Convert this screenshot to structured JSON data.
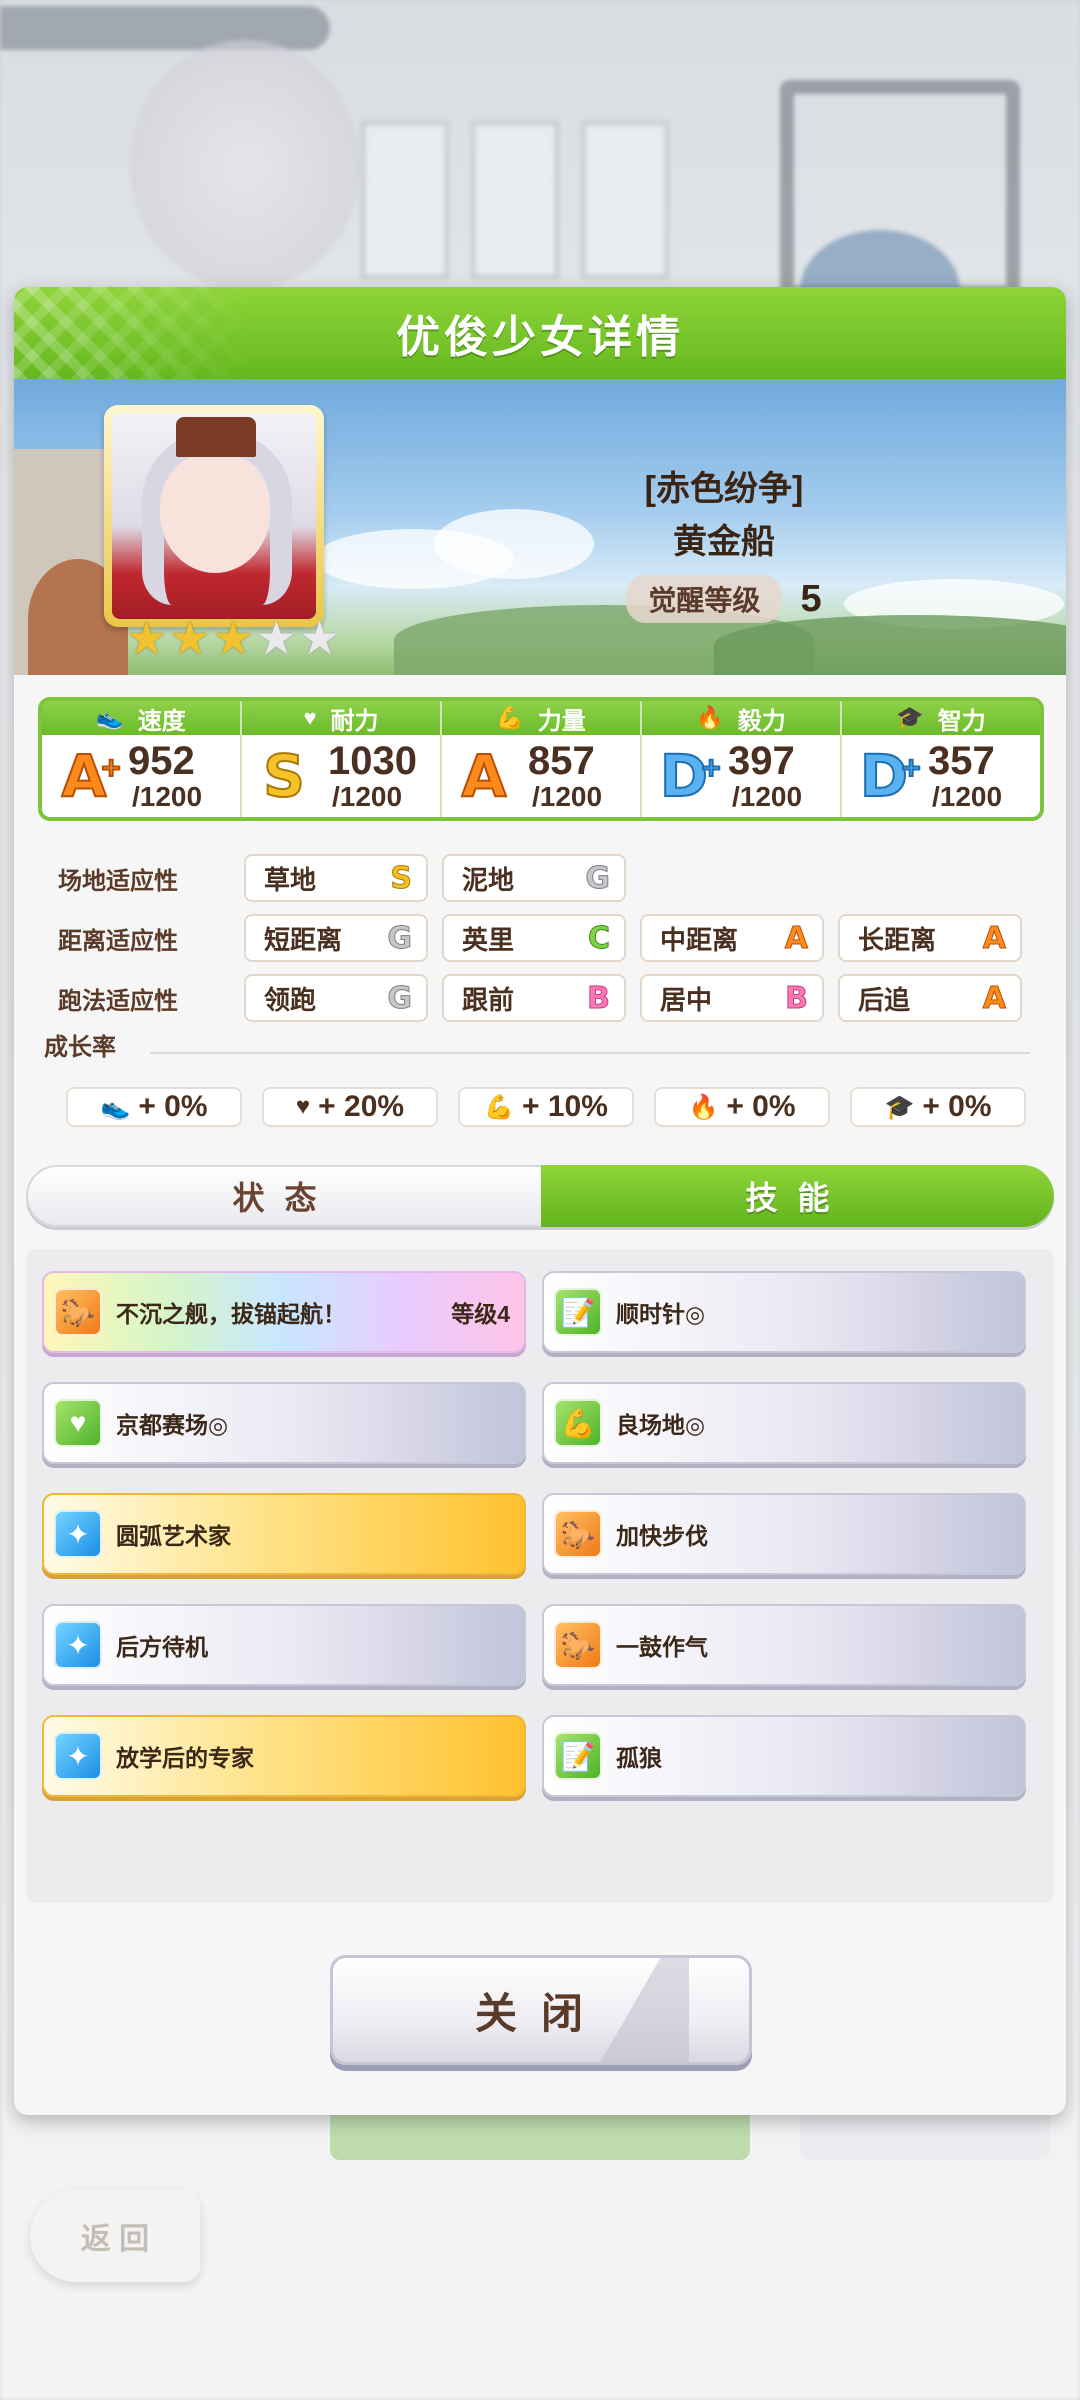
{
  "dialog": {
    "title": "优俊少女详情"
  },
  "background": {
    "back_label": "返 回"
  },
  "horse": {
    "epithet": "[赤色纷争]",
    "name": "黄金船",
    "awakening_label": "觉醒等级",
    "awakening_level": "5",
    "stars_filled": 3,
    "stars_total": 5
  },
  "stats": [
    {
      "label": "速度",
      "icon": "shoe-icon",
      "glyph": "👟",
      "grade": "A",
      "plus": "+",
      "grade_class": "g-A",
      "value": "952",
      "max": "/1200"
    },
    {
      "label": "耐力",
      "icon": "heart-icon",
      "glyph": "♥",
      "grade": "S",
      "plus": "",
      "grade_class": "g-S",
      "value": "1030",
      "max": "/1200"
    },
    {
      "label": "力量",
      "icon": "muscle-icon",
      "glyph": "💪",
      "grade": "A",
      "plus": "",
      "grade_class": "g-A",
      "value": "857",
      "max": "/1200"
    },
    {
      "label": "毅力",
      "icon": "flame-icon",
      "glyph": "🔥",
      "grade": "D",
      "plus": "+",
      "grade_class": "g-D",
      "value": "397",
      "max": "/1200"
    },
    {
      "label": "智力",
      "icon": "graduation-cap-icon",
      "glyph": "🎓",
      "grade": "D",
      "plus": "+",
      "grade_class": "g-D",
      "value": "357",
      "max": "/1200"
    }
  ],
  "aptitudes": {
    "track": {
      "label": "场地适应性",
      "items": [
        {
          "name": "草地",
          "grade": "S"
        },
        {
          "name": "泥地",
          "grade": "G"
        }
      ]
    },
    "distance": {
      "label": "距离适应性",
      "items": [
        {
          "name": "短距离",
          "grade": "G"
        },
        {
          "name": "英里",
          "grade": "C"
        },
        {
          "name": "中距离",
          "grade": "A"
        },
        {
          "name": "长距离",
          "grade": "A"
        }
      ]
    },
    "style": {
      "label": "跑法适应性",
      "items": [
        {
          "name": "领跑",
          "grade": "G"
        },
        {
          "name": "跟前",
          "grade": "B"
        },
        {
          "name": "居中",
          "grade": "B"
        },
        {
          "name": "后追",
          "grade": "A"
        }
      ]
    }
  },
  "growth": {
    "label": "成长率",
    "items": [
      {
        "icon": "shoe-icon",
        "glyph": "👟",
        "value": "+ 0%"
      },
      {
        "icon": "heart-icon",
        "glyph": "♥",
        "value": "+ 20%"
      },
      {
        "icon": "muscle-icon",
        "glyph": "💪",
        "value": "+ 10%"
      },
      {
        "icon": "flame-icon",
        "glyph": "🔥",
        "value": "+ 0%"
      },
      {
        "icon": "graduation-cap-icon",
        "glyph": "🎓",
        "value": "+ 0%"
      }
    ]
  },
  "tabs": {
    "status": "状态",
    "skill": "技能",
    "active": "skill"
  },
  "skills": [
    {
      "name": "不沉之舰，拔锚起航！",
      "level": "等级4",
      "style": "rainbow",
      "icon": "running-horse-icon",
      "color": "ic-orange",
      "glyph": "🐎"
    },
    {
      "name": "顺时针◎",
      "level": "",
      "style": "plain",
      "icon": "notes-icon",
      "color": "ic-green",
      "glyph": "📝"
    },
    {
      "name": "京都赛场◎",
      "level": "",
      "style": "plain",
      "icon": "heart-icon",
      "color": "ic-green",
      "glyph": "♥"
    },
    {
      "name": "良场地◎",
      "level": "",
      "style": "plain",
      "icon": "muscle-icon",
      "color": "ic-green",
      "glyph": "💪"
    },
    {
      "name": "圆弧艺术家",
      "level": "",
      "style": "gold",
      "icon": "sparkle-icon",
      "color": "ic-blue",
      "glyph": "✦"
    },
    {
      "name": "加快步伐",
      "level": "",
      "style": "plain",
      "icon": "running-horse-icon",
      "color": "ic-orange",
      "glyph": "🐎"
    },
    {
      "name": "后方待机",
      "level": "",
      "style": "plain",
      "icon": "sparkle-icon",
      "color": "ic-blue",
      "glyph": "✦"
    },
    {
      "name": "一鼓作气",
      "level": "",
      "style": "plain",
      "icon": "running-horse-icon",
      "color": "ic-orange",
      "glyph": "🐎"
    },
    {
      "name": "放学后的专家",
      "level": "",
      "style": "gold",
      "icon": "sparkle-icon",
      "color": "ic-blue",
      "glyph": "✦"
    },
    {
      "name": "孤狼",
      "level": "",
      "style": "plain",
      "icon": "notes-icon",
      "color": "ic-green",
      "glyph": "📝"
    }
  ],
  "close_label": "关闭",
  "colors": {
    "header_green": "#6cbb2a",
    "rank_orange": "#ff8a1c",
    "rank_gold": "#f5c22a",
    "rank_blue": "#5bb2f0",
    "text_brown": "#4a3020"
  }
}
